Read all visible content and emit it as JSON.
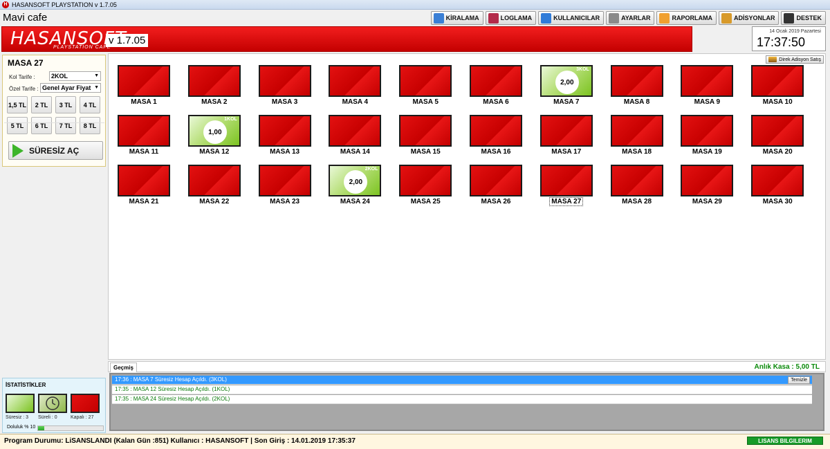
{
  "window": {
    "title": "HASANSOFT PLAYSTATION v 1.7.05"
  },
  "header": {
    "cafe_name": "Mavi cafe",
    "logo": "HASANSOFT",
    "logo_sub": "PLAYSTATION CAFE",
    "version": "v 1.7.05",
    "buttons": [
      {
        "label": "KİRALAMA",
        "icon": "home-icon",
        "color": "#3a7fd5"
      },
      {
        "label": "LOGLAMA",
        "icon": "log-icon",
        "color": "#b32b4a"
      },
      {
        "label": "KULLANICILAR",
        "icon": "user-icon",
        "color": "#2f7bd8"
      },
      {
        "label": "AYARLAR",
        "icon": "tools-icon",
        "color": "#8a8a8a"
      },
      {
        "label": "RAPORLAMA",
        "icon": "pie-chart-icon",
        "color": "#f0a030"
      },
      {
        "label": "ADİSYONLAR",
        "icon": "burger-icon",
        "color": "#d89a2a"
      },
      {
        "label": "DESTEK",
        "icon": "phone-icon",
        "color": "#333333"
      }
    ]
  },
  "clock": {
    "date": "14 Ocak 2019 Pazartesi",
    "time": "17:37:50"
  },
  "left_panel": {
    "selected_table": "MASA 27",
    "kol_label": "Kol Tarife :",
    "kol_value": "2KOL",
    "ozel_label": "Özel Tarife :",
    "ozel_value": "Genel Ayar Fiyat",
    "prices": [
      "1,5 TL",
      "2 TL",
      "3 TL",
      "4 TL",
      "5 TL",
      "6 TL",
      "7 TL",
      "8 TL"
    ],
    "start_button": "SÜRESİZ AÇ"
  },
  "main": {
    "direk_button": "Direk Adisyon Satış",
    "tables": [
      {
        "name": "MASA 1",
        "status": "closed"
      },
      {
        "name": "MASA 2",
        "status": "closed"
      },
      {
        "name": "MASA 3",
        "status": "closed"
      },
      {
        "name": "MASA 4",
        "status": "closed"
      },
      {
        "name": "MASA 5",
        "status": "closed"
      },
      {
        "name": "MASA 6",
        "status": "closed"
      },
      {
        "name": "MASA 7",
        "status": "open",
        "amount": "2,00",
        "kol": "3KOL"
      },
      {
        "name": "MASA 8",
        "status": "closed"
      },
      {
        "name": "MASA 9",
        "status": "closed"
      },
      {
        "name": "MASA 10",
        "status": "closed"
      },
      {
        "name": "MASA 11",
        "status": "closed"
      },
      {
        "name": "MASA 12",
        "status": "open",
        "amount": "1,00",
        "kol": "1KOL"
      },
      {
        "name": "MASA 13",
        "status": "closed"
      },
      {
        "name": "MASA 14",
        "status": "closed"
      },
      {
        "name": "MASA 15",
        "status": "closed"
      },
      {
        "name": "MASA 16",
        "status": "closed"
      },
      {
        "name": "MASA 17",
        "status": "closed"
      },
      {
        "name": "MASA 18",
        "status": "closed"
      },
      {
        "name": "MASA 19",
        "status": "closed"
      },
      {
        "name": "MASA 20",
        "status": "closed"
      },
      {
        "name": "MASA 21",
        "status": "closed"
      },
      {
        "name": "MASA 22",
        "status": "closed"
      },
      {
        "name": "MASA 23",
        "status": "closed"
      },
      {
        "name": "MASA 24",
        "status": "open",
        "amount": "2,00",
        "kol": "2KOL"
      },
      {
        "name": "MASA 25",
        "status": "closed"
      },
      {
        "name": "MASA 26",
        "status": "closed"
      },
      {
        "name": "MASA 27",
        "status": "closed",
        "selected": true
      },
      {
        "name": "MASA 28",
        "status": "closed"
      },
      {
        "name": "MASA 29",
        "status": "closed"
      },
      {
        "name": "MASA 30",
        "status": "closed"
      }
    ]
  },
  "history": {
    "tab": "Geçmiş",
    "kasa": "Anlık Kasa : 5,00 TL",
    "clear_button": "Temizle",
    "rows": [
      "17:36 : MASA 7 Süresiz Hesap Açıldı. (3KOL)",
      "17:35 : MASA 12 Süresiz Hesap Açıldı. (1KOL)",
      "17:35 : MASA 24 Süresiz Hesap Açıldı. (2KOL)"
    ]
  },
  "stats": {
    "title": "İSTATİSTİKLER",
    "suresiz": "Süresiz : 3",
    "sureli": "Süreli : 0",
    "kapali": "Kapalı : 27",
    "doluluk_label": "Doluluk % 10",
    "doluluk_fraction": 0.1
  },
  "statusbar": {
    "text": "Program Durumu: LiSANSLANDI (Kalan Gün :851)     Kullanıcı : HASANSOFT | Son Giriş : 14.01.2019 17:35:37",
    "license_button": "LISANS BILGILERIM"
  }
}
